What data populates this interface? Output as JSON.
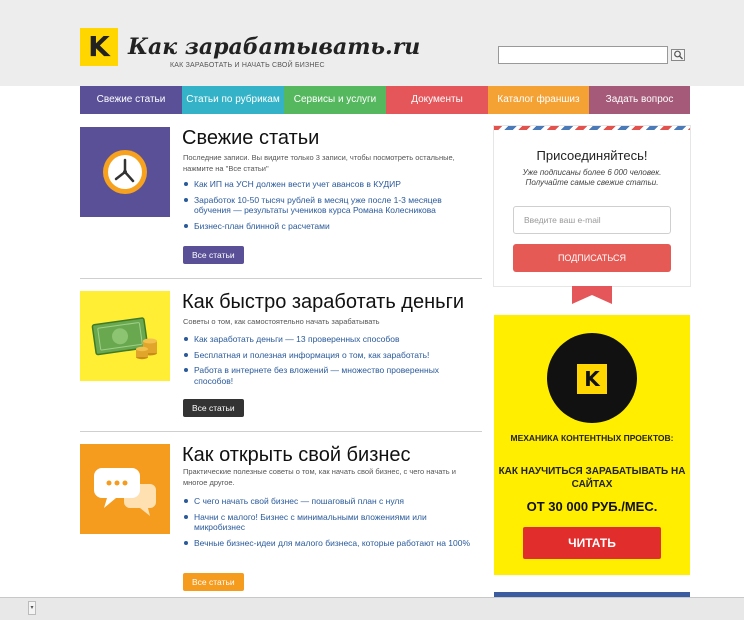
{
  "header": {
    "logo_letter": "K",
    "site_title": "Как зарабатывать.ru",
    "subtitle": "КАК ЗАРАБОТАТЬ И НАЧАТЬ СВОЙ БИЗНЕС",
    "search_value": ""
  },
  "nav": [
    {
      "label": "Свежие статьи",
      "color": "#5a5098"
    },
    {
      "label": "Статьи по рубрикам",
      "color": "#34b3c8"
    },
    {
      "label": "Сервисы и услуги",
      "color": "#55b85e"
    },
    {
      "label": "Документы",
      "color": "#e4565a"
    },
    {
      "label": "Каталог франшиз",
      "color": "#f5a235"
    },
    {
      "label": "Задать вопрос",
      "color": "#a45a78"
    }
  ],
  "sections": [
    {
      "title": "Свежие статьи",
      "desc": "Последние записи. Вы видите только 3 записи, чтобы посмотреть остальные, нажмите на \"Все статьи\"",
      "links": [
        "Как ИП на УСН должен вести учет авансов в КУДИР",
        "Заработок 10-50 тысяч рублей в месяц уже после 1-3 месяцев обучения — результаты учеников курса Романа Колесникова",
        "Бизнес-план блинной с расчетами"
      ],
      "button": "Все статьи",
      "icon_bg": "#5a5098",
      "button_color": "#5a5098"
    },
    {
      "title": "Как быстро заработать деньги",
      "desc": "Советы о том, как самостоятельно начать зарабатывать",
      "links": [
        "Как заработать деньги — 13 проверенных способов",
        "Бесплатная и полезная информация о том, как заработать!",
        "Работа в интернете без вложений — множество проверенных способов!"
      ],
      "button": "Все статьи",
      "icon_bg": "#ffee33",
      "button_color": "#333333"
    },
    {
      "title": "Как открыть свой бизнес",
      "desc": "Практические полезные советы о том, как начать свой бизнес, с чего начать и многое другое.",
      "links": [
        "С чего начать свой бизнес — пошаговый план с нуля",
        "Начни с малого! Бизнес с минимальными вложениями или микробизнес",
        "Вечные бизнес-идеи для малого бизнеса, которые работают на 100%"
      ],
      "button": "Все статьи",
      "icon_bg": "#f59b1e",
      "button_color": "#f59b1e"
    }
  ],
  "subscribe": {
    "title": "Присоединяйтесь!",
    "text": "Уже подписаны более 6 000 человек. Получайте самые свежие статьи.",
    "email_placeholder": "Введите ваш e-mail",
    "button": "ПОДПИСАТЬСЯ"
  },
  "ad": {
    "letter": "K",
    "line1": "МЕХАНИКА КОНТЕНТНЫХ ПРОЕКТОВ:",
    "line2": "КАК НАУЧИТЬСЯ ЗАРАБАТЫВАТЬ НА САЙТАХ",
    "line3": "ОТ 30 000 РУБ./МЕС.",
    "button": "ЧИТАТЬ"
  },
  "bottom": {
    "arrow": "▾"
  }
}
